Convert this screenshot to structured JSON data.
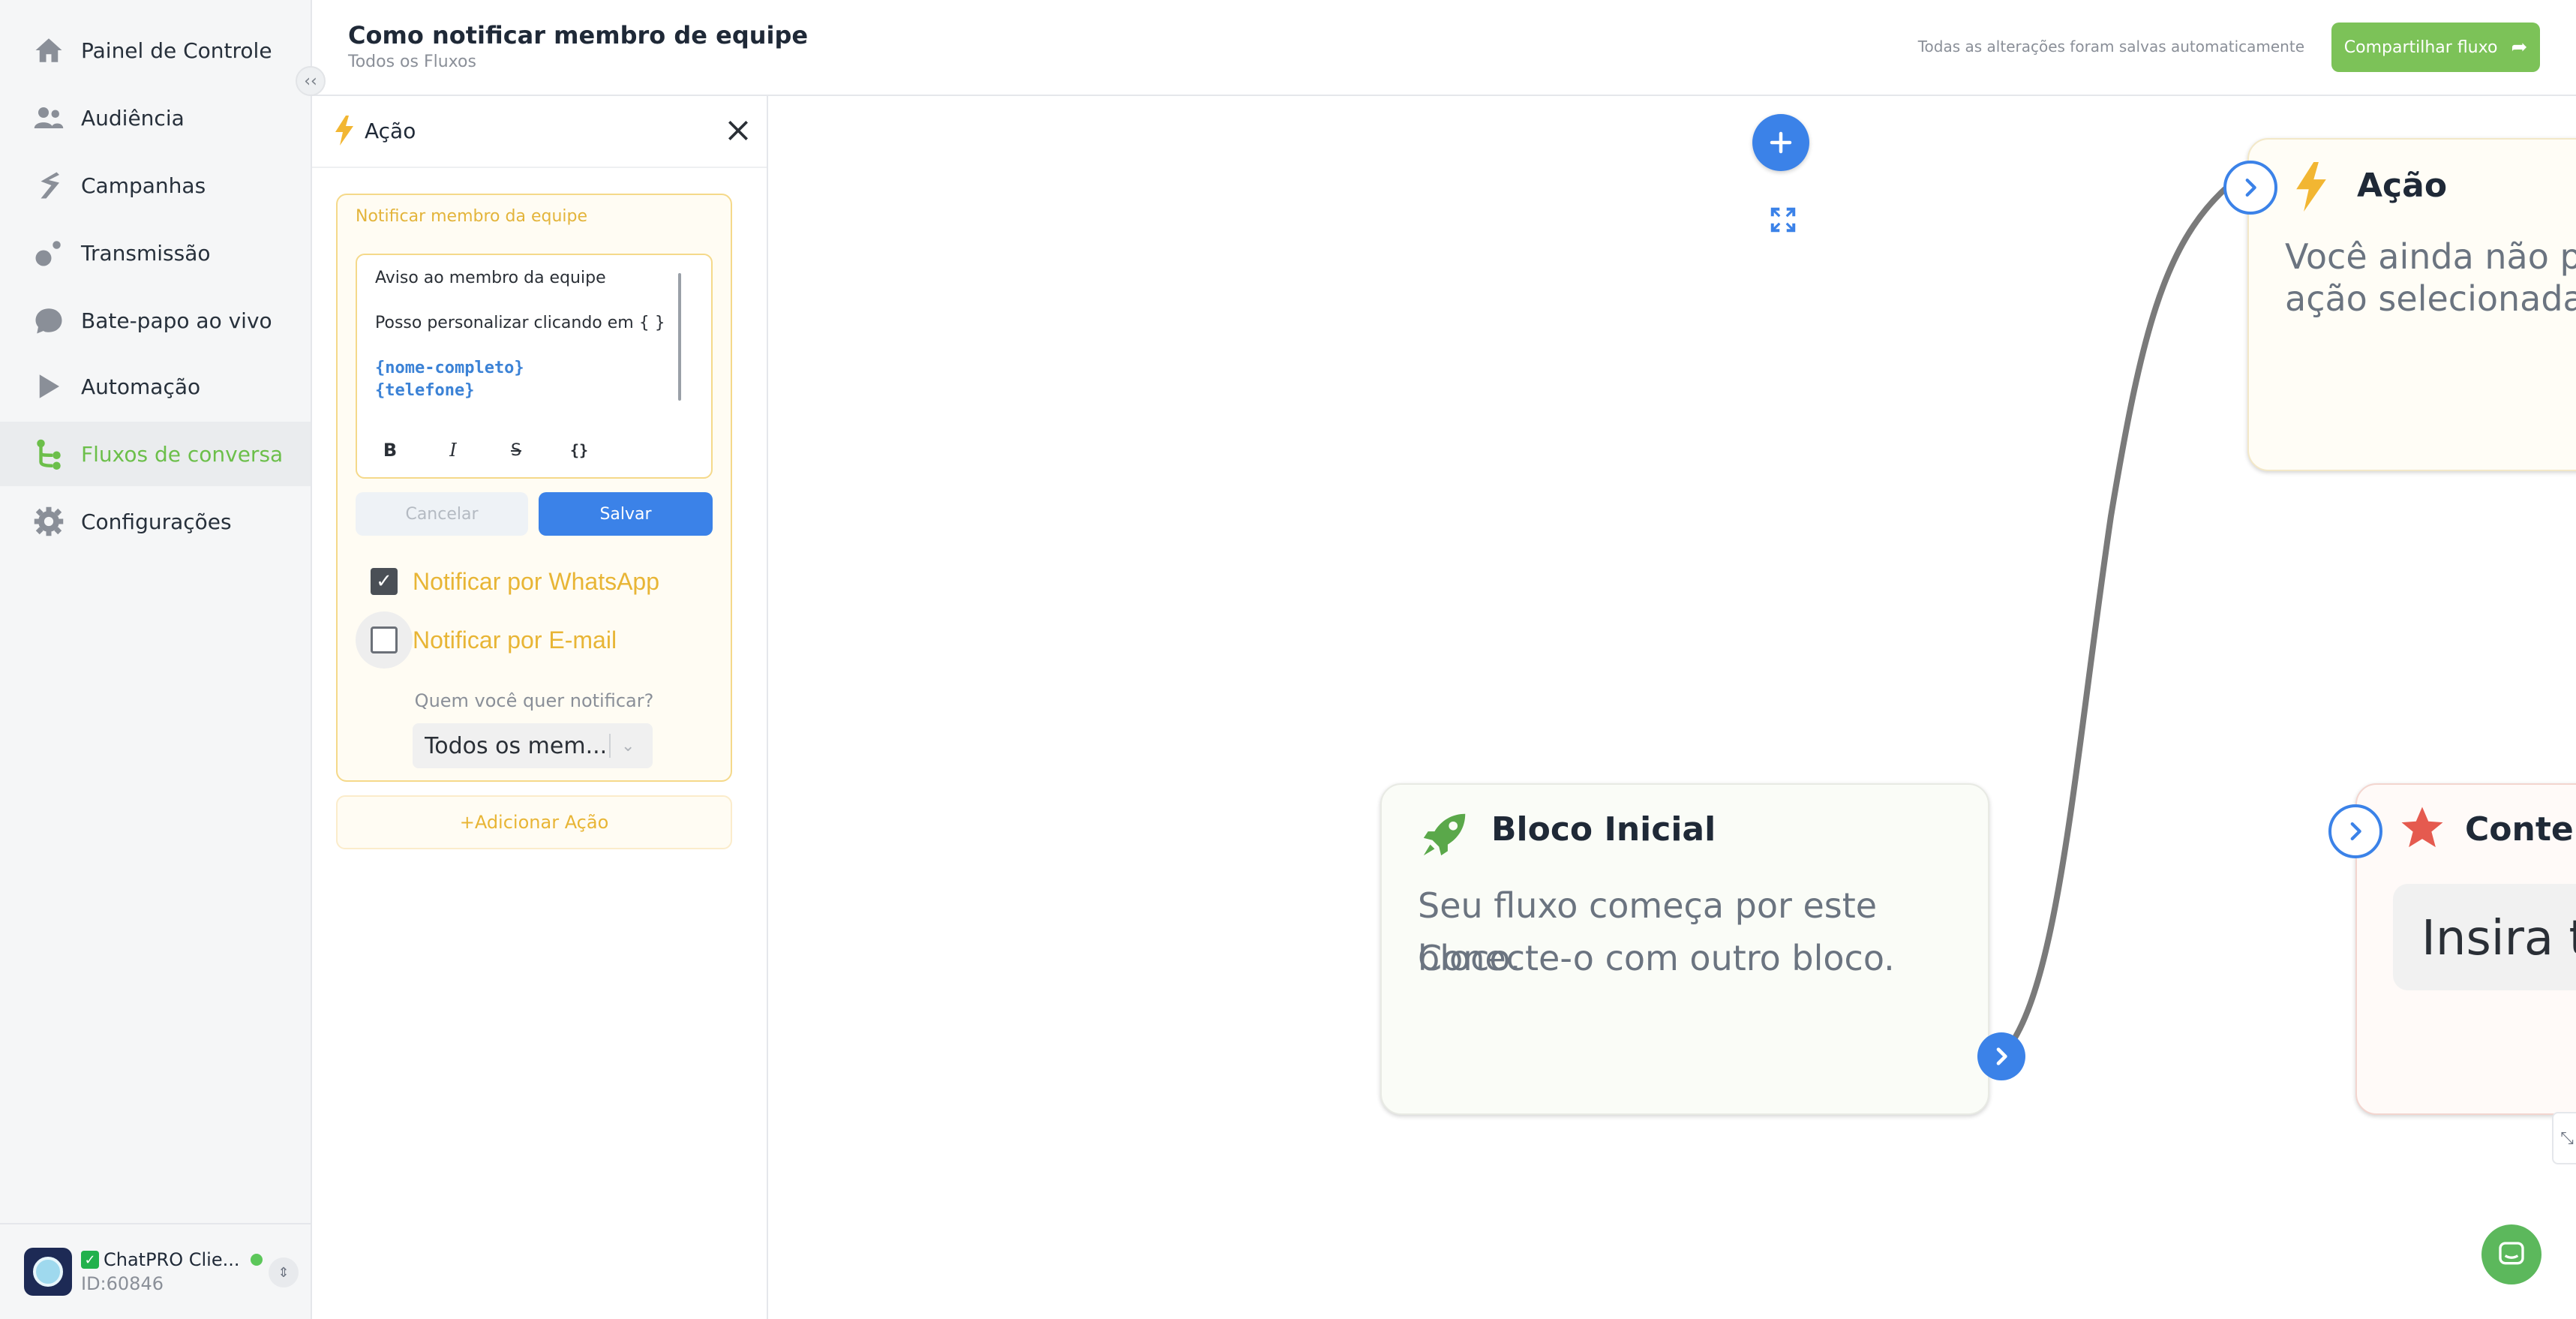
{
  "sidebar": {
    "items": [
      {
        "label": "Painel de Controle",
        "icon": "home-icon"
      },
      {
        "label": "Audiência",
        "icon": "users-icon"
      },
      {
        "label": "Campanhas",
        "icon": "campaign-icon"
      },
      {
        "label": "Transmissão",
        "icon": "broadcast-icon"
      },
      {
        "label": "Bate-papo ao vivo",
        "icon": "chat-bubble-icon"
      },
      {
        "label": "Automação",
        "icon": "automation-icon"
      },
      {
        "label": "Fluxos de conversa",
        "icon": "flow-icon"
      },
      {
        "label": "Configurações",
        "icon": "gear-icon"
      }
    ],
    "active_index": 6,
    "collapse_glyph": "‹‹",
    "account": {
      "name": "ChatPRO Clie...",
      "id": "ID:60846",
      "status": "online"
    }
  },
  "header": {
    "title": "Como notificar membro de equipe",
    "breadcrumb": "Todos os Fluxos",
    "autosave": "Todas as alterações foram salvas automaticamente",
    "share_label": "Compartilhar fluxo"
  },
  "panel": {
    "title": "Ação",
    "action": {
      "title": "Notificar membro da equipe",
      "message_lines": [
        "Aviso ao membro da equipe",
        "Posso personalizar clicando em { }"
      ],
      "variables": [
        "{nome-completo}",
        "{telefone}"
      ],
      "format_buttons": {
        "bold": "B",
        "italic": "I",
        "strike": "S",
        "code": "{}"
      },
      "cancel_label": "Cancelar",
      "save_label": "Salvar",
      "notify_whatsapp": {
        "label": "Notificar por WhatsApp",
        "checked": true
      },
      "notify_email": {
        "label": "Notificar por E-mail",
        "checked": false
      },
      "who_label": "Quem você quer notificar?",
      "who_selected": "Todos os mem..."
    },
    "add_action_label": "+Adicionar Ação"
  },
  "canvas": {
    "start_node": {
      "title": "Bloco Inicial",
      "body_line1": "Seu fluxo começa por este bloco.",
      "body_line2": "Conecte-o com outro bloco."
    },
    "action_node": {
      "title": "Ação",
      "body_line1": "Você ainda não po",
      "body_line2": "ação selecionada"
    },
    "content_node": {
      "title": "Conteú",
      "input_text": "Insira te"
    }
  },
  "colors": {
    "accent_green": "#7cc258",
    "primary_blue": "#3b82e8",
    "action_yellow": "#e8b535",
    "content_red": "#e55a4f"
  }
}
